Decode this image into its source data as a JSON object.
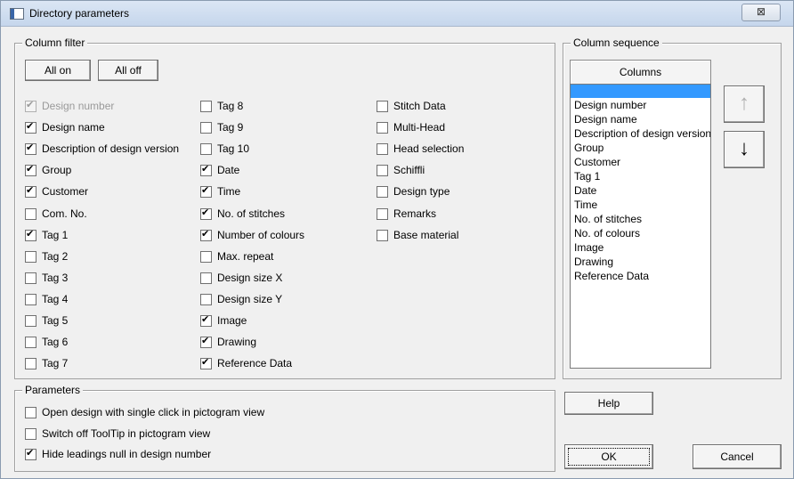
{
  "window": {
    "title": "Directory parameters",
    "close_glyph": "⊠"
  },
  "column_filter": {
    "label": "Column filter",
    "all_on": "All on",
    "all_off": "All off",
    "columns": [
      [
        {
          "label": "Design number",
          "checked": true,
          "disabled": true
        },
        {
          "label": "Design name",
          "checked": true
        },
        {
          "label": "Description of design version",
          "checked": true
        },
        {
          "label": "Group",
          "checked": true
        },
        {
          "label": "Customer",
          "checked": true
        },
        {
          "label": "Com. No.",
          "checked": false
        },
        {
          "label": "Tag 1",
          "checked": true
        },
        {
          "label": "Tag 2",
          "checked": false
        },
        {
          "label": "Tag 3",
          "checked": false
        },
        {
          "label": "Tag 4",
          "checked": false
        },
        {
          "label": "Tag 5",
          "checked": false
        },
        {
          "label": "Tag 6",
          "checked": false
        },
        {
          "label": "Tag 7",
          "checked": false
        }
      ],
      [
        {
          "label": "Tag 8",
          "checked": false
        },
        {
          "label": "Tag 9",
          "checked": false
        },
        {
          "label": "Tag 10",
          "checked": false
        },
        {
          "label": "Date",
          "checked": true
        },
        {
          "label": "Time",
          "checked": true
        },
        {
          "label": "No. of stitches",
          "checked": true
        },
        {
          "label": "Number of colours",
          "checked": true
        },
        {
          "label": "Max. repeat",
          "checked": false
        },
        {
          "label": "Design size X",
          "checked": false
        },
        {
          "label": "Design size Y",
          "checked": false
        },
        {
          "label": "Image",
          "checked": true
        },
        {
          "label": "Drawing",
          "checked": true
        },
        {
          "label": "Reference Data",
          "checked": true
        }
      ],
      [
        {
          "label": "Stitch Data",
          "checked": false
        },
        {
          "label": "Multi-Head",
          "checked": false
        },
        {
          "label": "Head selection",
          "checked": false
        },
        {
          "label": "Schiffli",
          "checked": false
        },
        {
          "label": "Design type",
          "checked": false
        },
        {
          "label": "Remarks",
          "checked": false
        },
        {
          "label": "Base material",
          "checked": false
        }
      ]
    ]
  },
  "column_sequence": {
    "label": "Column sequence",
    "header": "Columns",
    "items": [
      "Design number",
      "Design name",
      "Description of design version",
      "Group",
      "Customer",
      "Tag 1",
      "Date",
      "Time",
      "No. of stitches",
      "No. of colours",
      "Image",
      "Drawing",
      "Reference Data"
    ],
    "up_glyph": "↑",
    "down_glyph": "↓"
  },
  "parameters": {
    "label": "Parameters",
    "options": [
      {
        "label": "Open design with single click in pictogram view",
        "checked": false
      },
      {
        "label": "Switch off ToolTip in pictogram view",
        "checked": false
      },
      {
        "label": "Hide leadings null in design number",
        "checked": true
      }
    ]
  },
  "buttons": {
    "help": "Help",
    "ok": "OK",
    "cancel": "Cancel"
  }
}
